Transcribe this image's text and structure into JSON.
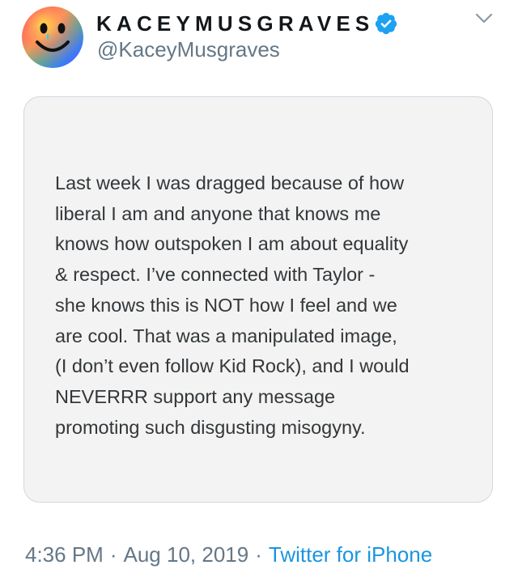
{
  "author": {
    "display_name": "KACEYMUSGRAVES",
    "handle": "@KaceyMusgraves",
    "verified": true,
    "avatar_icon": "rainbow-smiley-avatar",
    "verified_icon": "verified-badge-icon",
    "menu_icon": "chevron-down-icon"
  },
  "image_card": {
    "text": "Last week I was dragged because of how\nliberal I am and anyone that knows me\nknows how outspoken I am about equality\n& respect. I’ve connected with Taylor -\nshe knows this is NOT how I feel and we\nare cool. That was a manipulated image,\n(I don’t even follow Kid Rock), and I would\nNEVERRR support any message\npromoting such disgusting misogyny."
  },
  "meta": {
    "time": "4:36 PM",
    "separator": "·",
    "date": "Aug 10, 2019",
    "source": "Twitter for iPhone"
  },
  "colors": {
    "accent": "#1b95e0",
    "muted": "#657786",
    "card_bg": "#f3f3f3",
    "card_border": "#cfd8e0"
  }
}
